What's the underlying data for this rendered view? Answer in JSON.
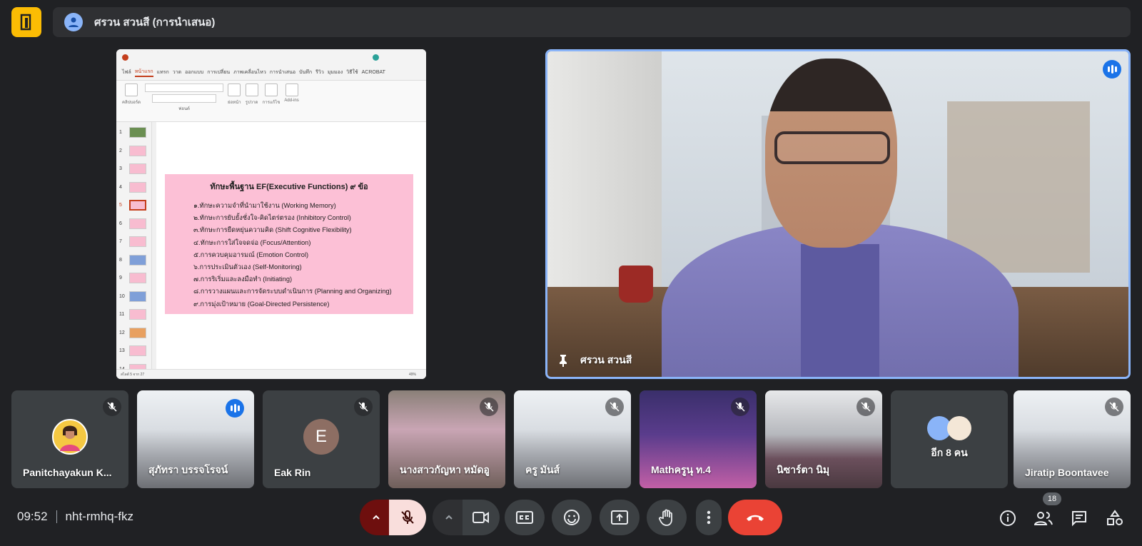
{
  "header": {
    "presenter_label": "ศรวน สวนสี (การนำเสนอ)"
  },
  "presentation": {
    "slide_title": "ทักษะพื้นฐาน EF(Executive Functions) ๙ ข้อ",
    "lines": [
      "๑.ทักษะความจำที่นำมาใช้งาน (Working Memory)",
      "๒.ทักษะการยับยั้งชั่งใจ-คิดไตร่ตรอง (Inhibitory Control)",
      "๓.ทักษะการยืดหยุ่นความคิด (Shift Cognitive Flexibility)",
      "๔.ทักษะการใส่ใจจดจ่อ (Focus/Attention)",
      "๕.การควบคุมอารมณ์ (Emotion Control)",
      "๖.การประเมินตัวเอง (Self-Monitoring)",
      "๗.การริเริ่มและลงมือทำ (Initiating)",
      "๘.การวางแผนและการจัดระบบดำเนินการ (Planning and Organizing)",
      "๙.การมุ่งเป้าหมาย (Goal-Directed Persistence)"
    ],
    "ribbon_tabs": [
      "ไฟล์",
      "หน้าแรก",
      "แทรก",
      "วาด",
      "ออกแบบ",
      "การเปลี่ยน",
      "ภาพเคลื่อนไหว",
      "การนำเสนอ",
      "บันทึก",
      "รีวิว",
      "มุมมอง",
      "วิธีใช้",
      "ACROBAT"
    ],
    "ribbon_groups": [
      "คลิปบอร์ด",
      "ฟอนต์",
      "ย่อหน้า",
      "รูปวาด",
      "การแก้ไข",
      "Add-ins"
    ],
    "thumb_numbers": [
      "1",
      "2",
      "3",
      "4",
      "5",
      "6",
      "7",
      "8",
      "9",
      "10",
      "11",
      "12",
      "13",
      "14"
    ],
    "status": "สไลด์ 5 จาก 27",
    "zoom": "49%"
  },
  "main_video": {
    "name": "ศรวน สวนสี"
  },
  "participants": [
    {
      "name": "Panitchayakun K..."
    },
    {
      "name": "สุภัทรา บรรจโรจน์"
    },
    {
      "name": "Eak Rin",
      "initial": "E"
    },
    {
      "name": "นางสาวกัญหา หมัดอู"
    },
    {
      "name": "ครู มันส์"
    },
    {
      "name": "Mathครูนุ ท.4"
    },
    {
      "name": "นิซาร์ตา นิมุ"
    },
    {
      "name": "อีก 8 คน"
    },
    {
      "name": "Jiratip Boontavee"
    }
  ],
  "footer": {
    "time": "09:52",
    "meeting_code": "nht-rmhq-fkz",
    "people_count": "18"
  },
  "colors": {
    "accent": "#8ab4f8",
    "leave": "#ea4335",
    "logo": "#fbbc04",
    "slide_bg": "#fcc0d6"
  }
}
